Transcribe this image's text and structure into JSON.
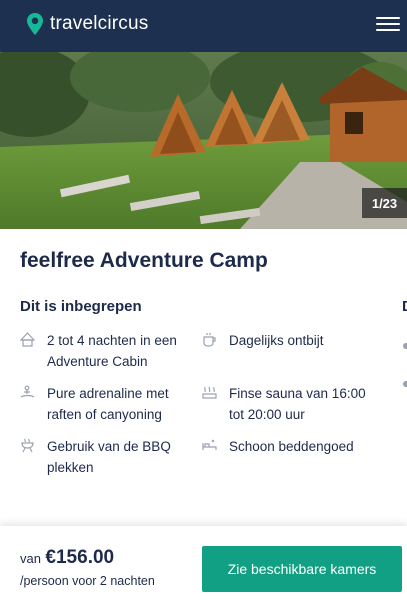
{
  "header": {
    "logo_text": "travelcircus",
    "logo_icon": "map-pin-icon",
    "menu_icon": "hamburger-menu-icon",
    "background": "#1d3050"
  },
  "gallery": {
    "counter": "1/23"
  },
  "offer": {
    "title": "feelfree Adventure Camp",
    "included_heading": "Dit is inbegrepen",
    "next_column_heading_peek": "D",
    "items": [
      {
        "icon": "cabin-icon",
        "text": "2 tot 4 nachten in een Adventure Cabin"
      },
      {
        "icon": "coffee-cup-icon",
        "text": "Dagelijks ontbijt"
      },
      {
        "icon": "rafting-icon",
        "text": "Pure adrenaline met raften of canyoning"
      },
      {
        "icon": "sauna-icon",
        "text": "Finse sauna van 16:00 tot 20:00 uur"
      },
      {
        "icon": "bbq-icon",
        "text": "Gebruik van de BBQ plekken"
      },
      {
        "icon": "bedding-icon",
        "text": "Schoon beddengoed"
      }
    ]
  },
  "booking": {
    "price_prefix": "van",
    "price": "€156.00",
    "price_note": "/persoon voor 2 nachten",
    "cta_label": "Zie beschikbare kamers",
    "cta_color": "#12a085"
  }
}
